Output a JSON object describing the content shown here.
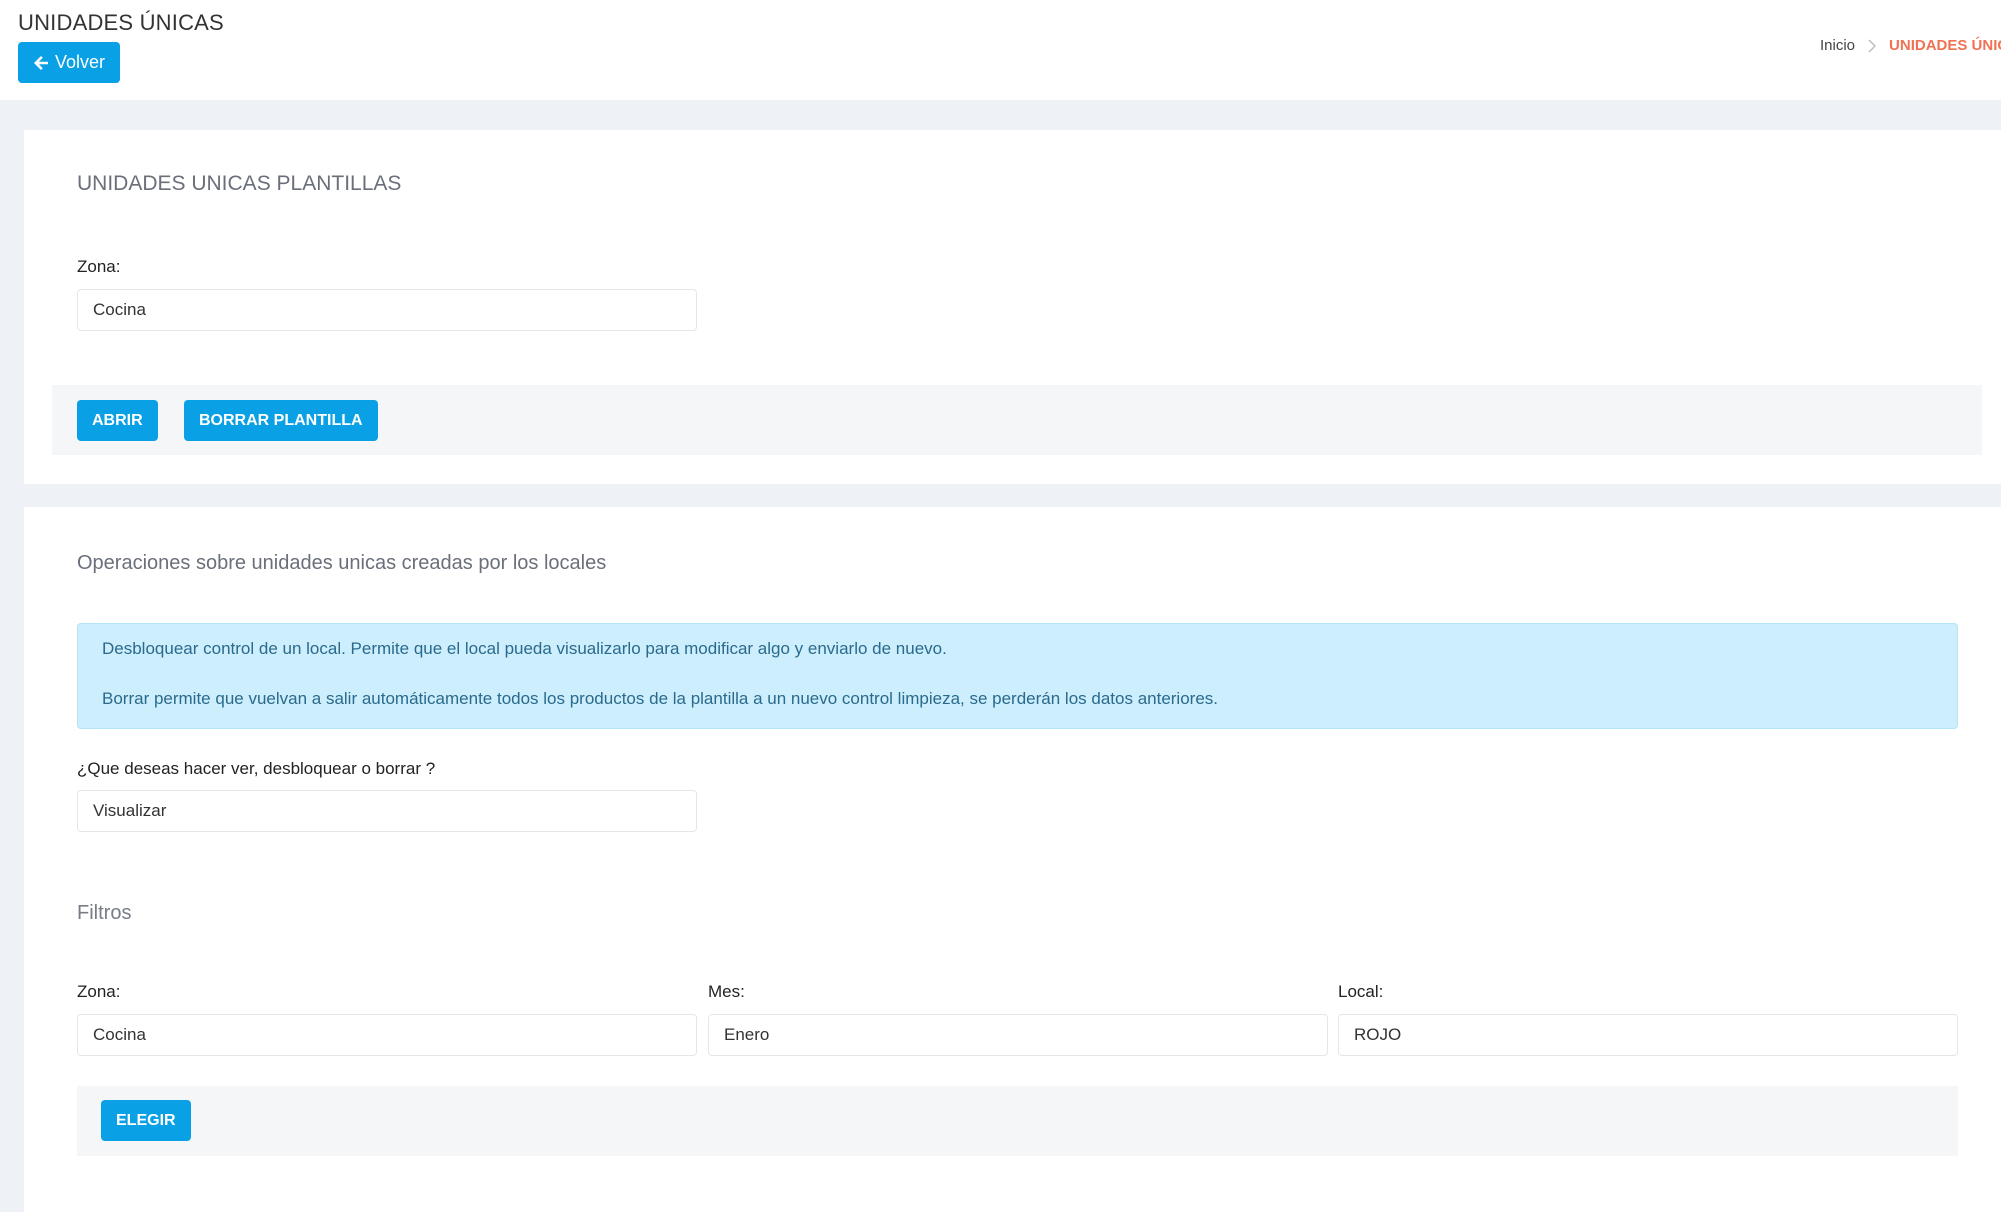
{
  "header": {
    "title": "UNIDADES ÚNICAS",
    "back_label": "Volver",
    "breadcrumb": {
      "home": "Inicio",
      "current": "UNIDADES ÚNICA"
    }
  },
  "plantillas": {
    "heading": "UNIDADES UNICAS PLANTILLAS",
    "zona_label": "Zona:",
    "zona_value": "Cocina",
    "abrir_label": "ABRIR",
    "borrar_label": "BORRAR PLANTILLA"
  },
  "operaciones": {
    "heading": "Operaciones sobre unidades unicas creadas por los locales",
    "info_line1": "Desbloquear control de un local. Permite que el local pueda visualizarlo para modificar algo y enviarlo de nuevo.",
    "info_line2": "Borrar permite que vuelvan a salir automáticamente todos los productos de la plantilla a un nuevo control limpieza, se perderán los datos anteriores.",
    "question_label": "¿Que deseas hacer ver, desbloquear o borrar ?",
    "question_value": "Visualizar"
  },
  "filtros": {
    "heading": "Filtros",
    "zona_label": "Zona:",
    "zona_value": "Cocina",
    "mes_label": "Mes:",
    "mes_value": "Enero",
    "local_label": "Local:",
    "local_value": "ROJO",
    "elegir_label": "ELEGIR"
  }
}
